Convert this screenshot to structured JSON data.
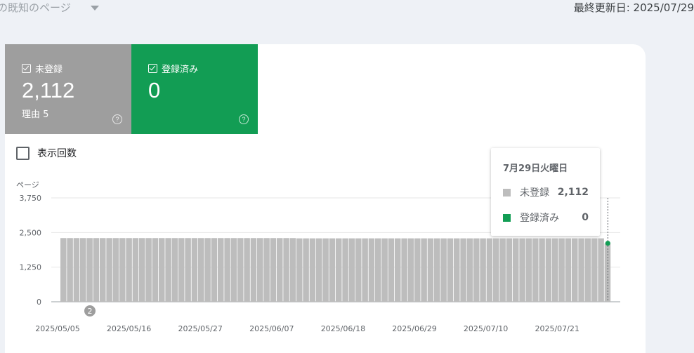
{
  "header": {
    "title_fragment": "の既知のページ",
    "last_updated": "最終更新日: 2025/07/29"
  },
  "tiles": {
    "unregistered": {
      "label": "未登録",
      "value": "2,112",
      "sub": "理由 5",
      "help": "?"
    },
    "registered": {
      "label": "登録済み",
      "value": "0",
      "help": "?"
    }
  },
  "impressions_label": "表示回数",
  "tooltip": {
    "date": "7月29日火曜日",
    "rows": [
      {
        "label": "未登録",
        "value": "2,112",
        "color": "#bdbdbd"
      },
      {
        "label": "登録済み",
        "value": "0",
        "color": "#129d54"
      }
    ]
  },
  "chart_data": {
    "type": "bar",
    "ylabel": "ページ",
    "ylim": [
      0,
      3750
    ],
    "yticks": [
      "0",
      "1,250",
      "2,500",
      "3,750"
    ],
    "xticks": [
      "2025/05/05",
      "2025/05/16",
      "2025/05/27",
      "2025/06/07",
      "2025/06/18",
      "2025/06/29",
      "2025/07/10",
      "2025/07/21"
    ],
    "annotation": "2",
    "series": [
      {
        "name": "未登録",
        "color": "#bdbdbd",
        "values": [
          2300,
          2300,
          2300,
          2300,
          2300,
          2300,
          2300,
          2300,
          2300,
          2300,
          2300,
          2300,
          2300,
          2300,
          2300,
          2300,
          2300,
          2300,
          2300,
          2300,
          2300,
          2300,
          2300,
          2300,
          2300,
          2300,
          2300,
          2300,
          2300,
          2300,
          2300,
          2300,
          2300,
          2300,
          2300,
          2300,
          2290,
          2290,
          2290,
          2290,
          2290,
          2290,
          2290,
          2290,
          2290,
          2290,
          2290,
          2290,
          2290,
          2290,
          2290,
          2290,
          2290,
          2290,
          2290,
          2290,
          2290,
          2290,
          2290,
          2290,
          2290,
          2290,
          2290,
          2290,
          2290,
          2290,
          2290,
          2290,
          2290,
          2290,
          2290,
          2290,
          2290,
          2290,
          2290,
          2290,
          2290,
          2290,
          2290,
          2290,
          2290,
          2290,
          2290,
          2112
        ]
      },
      {
        "name": "登録済み",
        "color": "#129d54",
        "values": [
          0
        ]
      }
    ]
  }
}
